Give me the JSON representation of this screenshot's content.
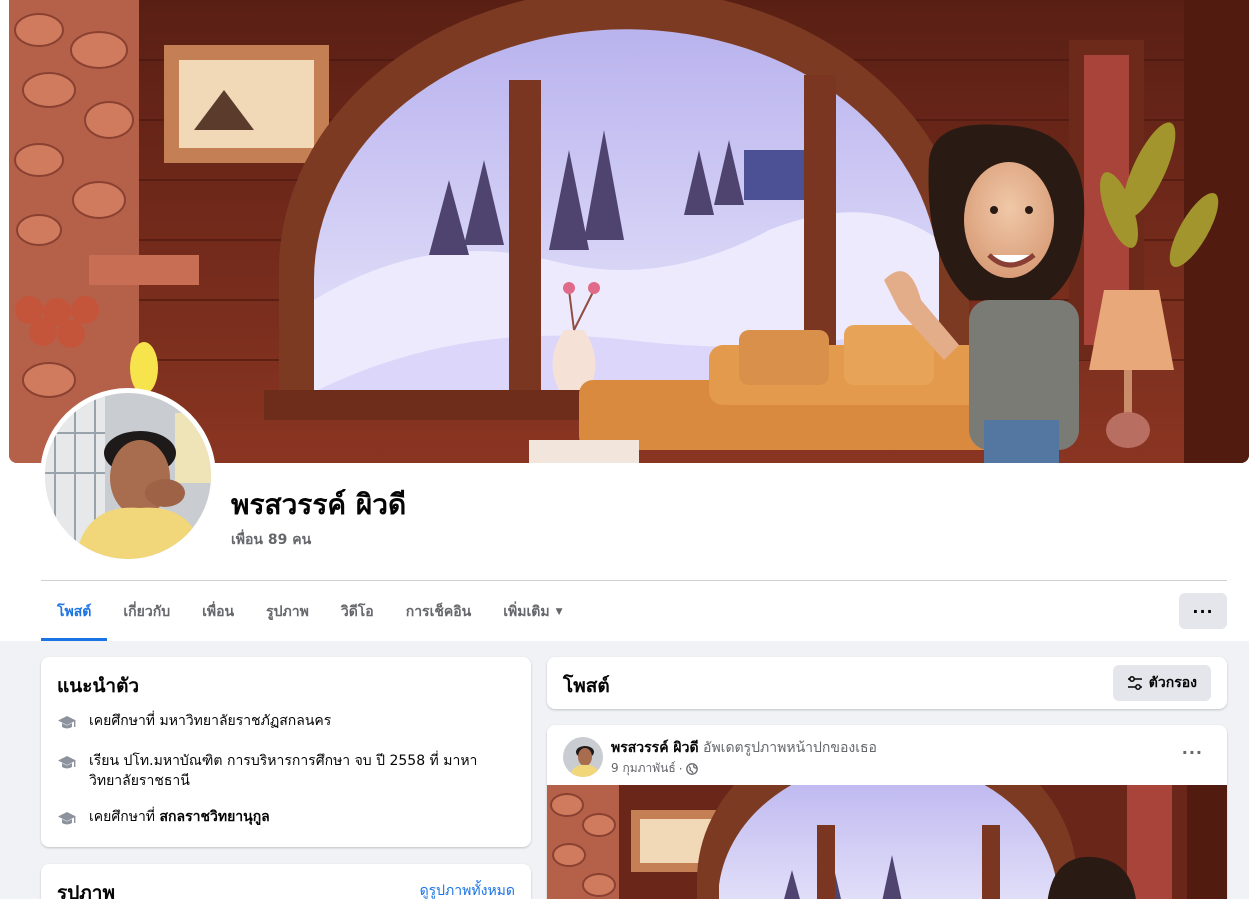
{
  "profile": {
    "name": "พรสวรรค์ ผิวดี",
    "friends": "เพื่อน 89 คน"
  },
  "tabs": [
    {
      "label": "โพสต์",
      "active": true
    },
    {
      "label": "เกี่ยวกับ"
    },
    {
      "label": "เพื่อน"
    },
    {
      "label": "รูปภาพ"
    },
    {
      "label": "วิดีโอ"
    },
    {
      "label": "การเช็คอิน"
    },
    {
      "label": "เพิ่มเติม"
    }
  ],
  "more_button": "···",
  "intro": {
    "title": "แนะนำตัว",
    "items": [
      {
        "prefix": "เคยศึกษาที่ ",
        "text": "มหาวิทยาลัยราชภัฏสกลนคร"
      },
      {
        "prefix": "",
        "text": "เรียน ปโท.มหาบัณฑิต การบริหารการศึกษา จบ ปี 2558 ที่ มาหา",
        "text2": "วิทยาลัยราชธานี"
      },
      {
        "prefix": "เคยศึกษาที่ ",
        "text": "สกลราชวิทยานุกูล"
      }
    ]
  },
  "photos": {
    "title": "รูปภาพ",
    "see_all": "ดูรูปภาพทั้งหมด"
  },
  "posts": {
    "title": "โพสต์",
    "filter": "ตัวกรอง"
  },
  "post": {
    "author": "พรสวรรค์ ผิวดี",
    "action": "อัพเดตรูปภาพหน้าปกของเธอ",
    "date": "9 กุมภาพันธ์",
    "separator": "·",
    "dots": "···"
  },
  "colors": {
    "accent": "#1b74e4",
    "secondary_text": "#65676b",
    "page_bg": "#f0f2f5"
  },
  "icons": [
    "graduation-cap-icon",
    "filter-icon",
    "globe-icon",
    "caret-down-icon",
    "more-dots-icon"
  ]
}
